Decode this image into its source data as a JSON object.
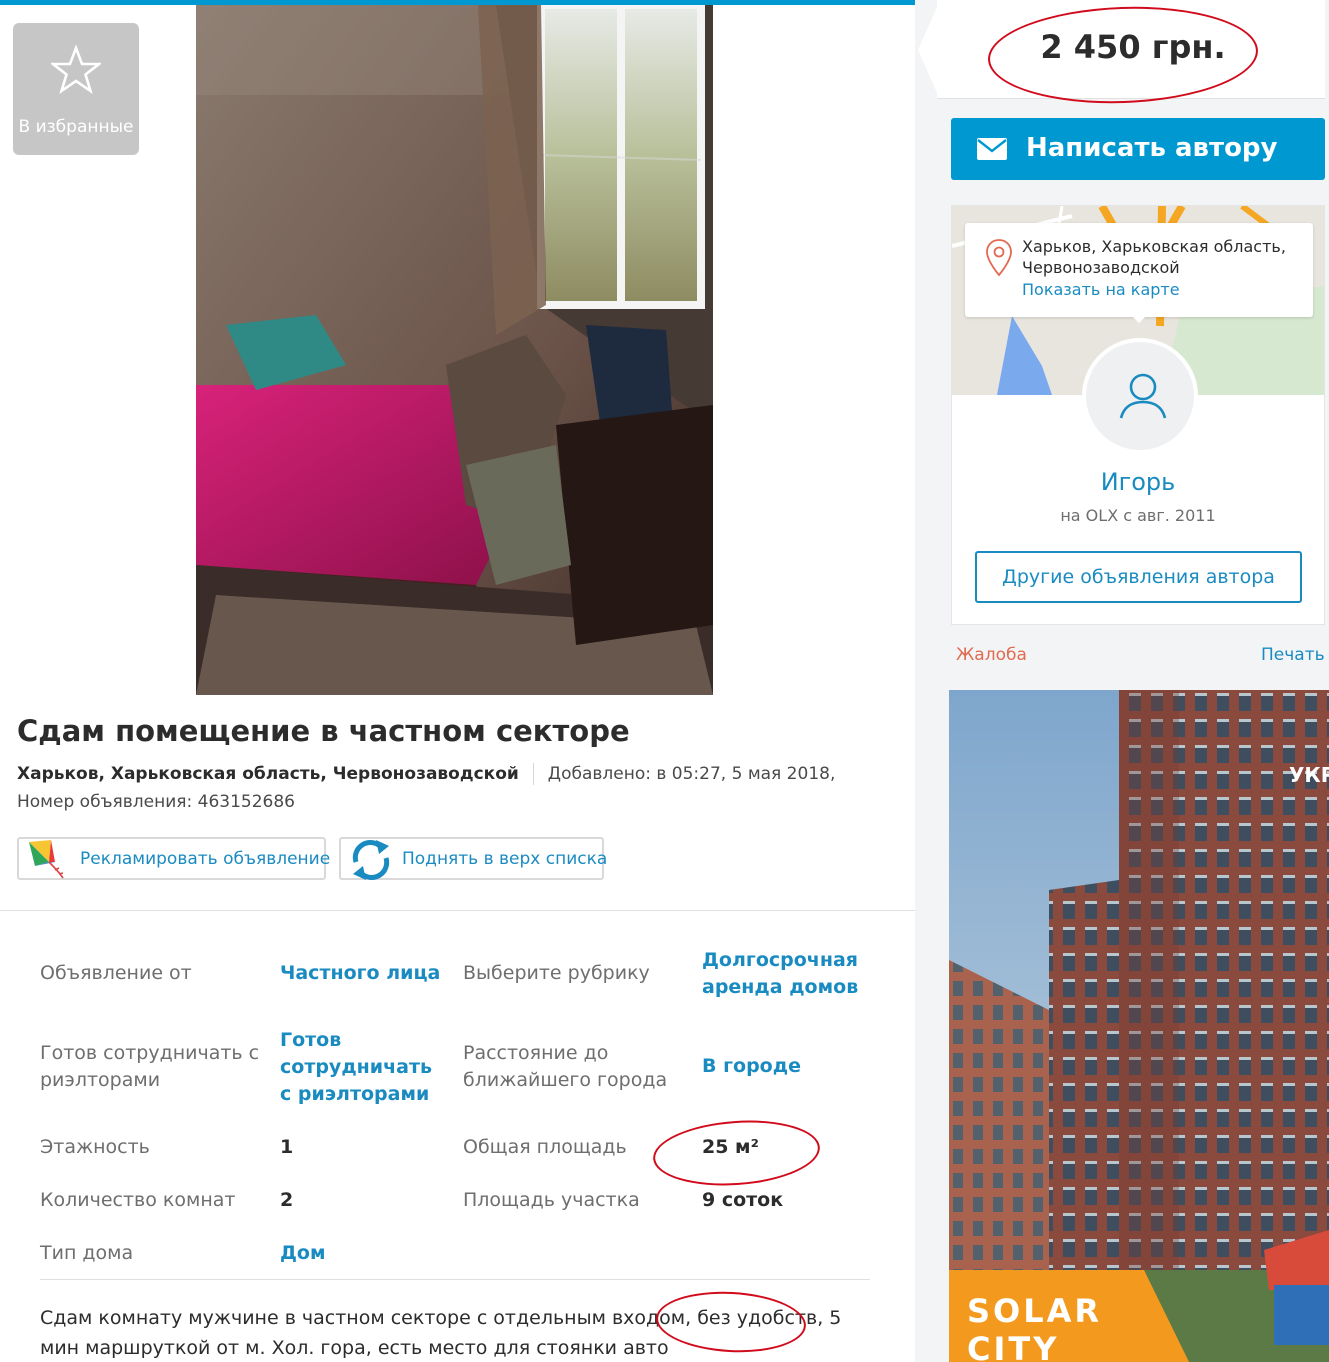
{
  "favorites": {
    "label": "В избранные",
    "icon": "star-outline-icon"
  },
  "photo": {
    "alt": "room photo"
  },
  "ad": {
    "title": "Сдам помещение в частном секторе",
    "location": "Харьков, Харьковская область, Червонозаводской",
    "added": "Добавлено: в 05:27, 5 мая 2018,",
    "number": "Номер объявления: 463152686"
  },
  "actions": {
    "promote_label": "Рекламировать объявление",
    "raise_label": "Поднять в верх списка"
  },
  "params": [
    {
      "label": "Объявление от",
      "value": "Частного лица",
      "link": true
    },
    {
      "label": "Выберите рубрику",
      "value": "Долгосрочная аренда домов",
      "link": true
    },
    {
      "label": "Готов сотрудничать с риэлторами",
      "value": "Готов сотрудничать с риэлторами",
      "link": true
    },
    {
      "label": "Расстояние до ближайшего города",
      "value": "В городе",
      "link": true
    },
    {
      "label": "Этажность",
      "value": "1",
      "link": false
    },
    {
      "label": "Общая площадь",
      "value": "25 м²",
      "link": false
    },
    {
      "label": "Количество комнат",
      "value": "2",
      "link": false
    },
    {
      "label": "Площадь участка",
      "value": "9 соток",
      "link": false
    },
    {
      "label": "Тип дома",
      "value": "Дом",
      "link": true
    }
  ],
  "description": "Сдам комнату мужчине в частном секторе с отдельным входом, без удобств, 5 мин маршруткой от м. Хол. гора, есть место для стоянки авто",
  "price": "2 450 грн.",
  "contact": {
    "write_label": "Написать автору",
    "icon": "envelope-icon"
  },
  "seller": {
    "address": "Харьков, Харьковская область, Червонозаводской",
    "map_link": "Показать на карте",
    "name": "Игорь",
    "since": "на OLX с авг. 2011",
    "other_ads_label": "Другие объявления автора"
  },
  "footer_links": {
    "complain": "Жалоба",
    "print": "Печать"
  },
  "banner": {
    "brand_line1": "SOLAR",
    "brand_line2": "CITY",
    "corner_text": "УКР"
  },
  "colors": {
    "accent": "#0098d0",
    "link": "#1a8bc1",
    "annotation": "#d10b1b",
    "complain": "#e16a51"
  }
}
